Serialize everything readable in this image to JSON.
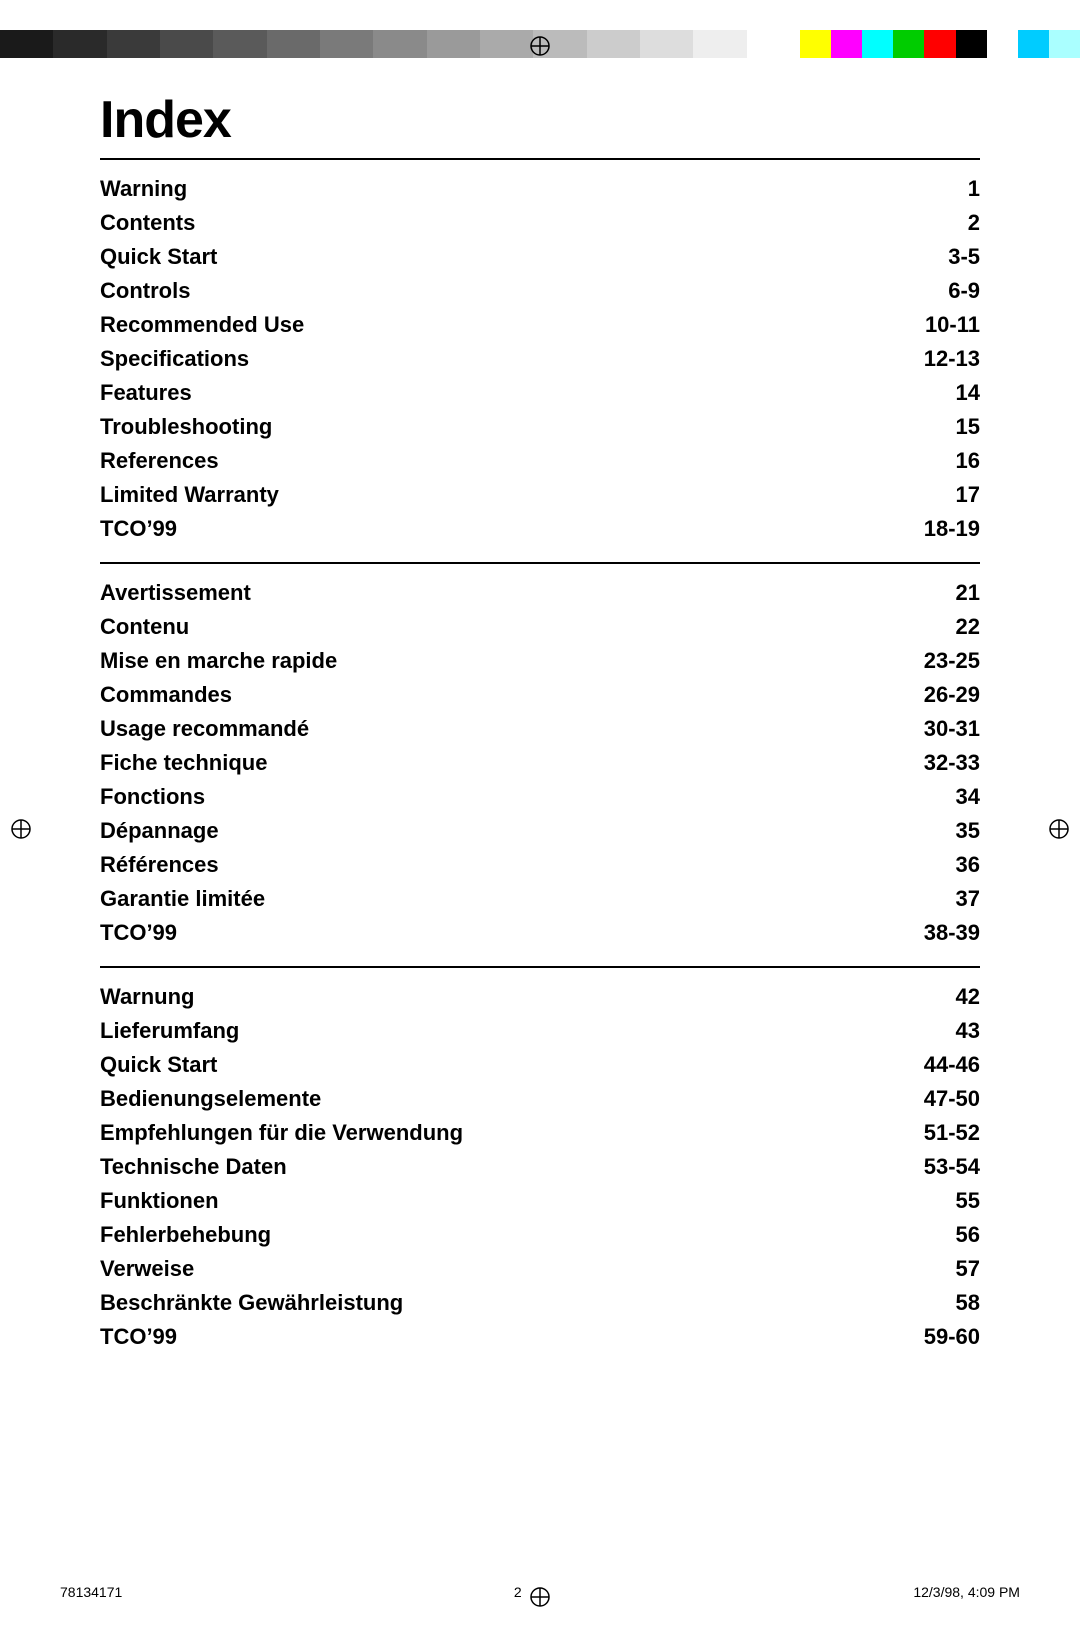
{
  "colorBar": {
    "swatches": [
      "#1a1a1a",
      "#333333",
      "#4d4d4d",
      "#666666",
      "#808080",
      "#999999",
      "#b3b3b3",
      "#cccccc",
      "#e6e6e6",
      "#ffffff",
      "#ffff00",
      "#ff00ff",
      "#00ffff",
      "#00cc00",
      "#ff0000",
      "#000000",
      "#ffffff",
      "#00ccff",
      "#ffffff"
    ]
  },
  "pageTitle": "Index",
  "sections": [
    {
      "id": "english",
      "items": [
        {
          "label": "Warning",
          "page": "1"
        },
        {
          "label": "Contents",
          "page": "2"
        },
        {
          "label": "Quick Start",
          "page": "3-5"
        },
        {
          "label": "Controls",
          "page": "6-9"
        },
        {
          "label": "Recommended Use",
          "page": "10-11"
        },
        {
          "label": "Specifications",
          "page": "12-13"
        },
        {
          "label": "Features",
          "page": "14"
        },
        {
          "label": "Troubleshooting",
          "page": "15"
        },
        {
          "label": "References",
          "page": "16"
        },
        {
          "label": "Limited Warranty",
          "page": "17"
        },
        {
          "label": "TCO’99",
          "page": "18-19"
        }
      ]
    },
    {
      "id": "french",
      "items": [
        {
          "label": "Avertissement",
          "page": "21"
        },
        {
          "label": "Contenu",
          "page": "22"
        },
        {
          "label": "Mise en marche rapide",
          "page": "23-25"
        },
        {
          "label": "Commandes",
          "page": "26-29"
        },
        {
          "label": "Usage recommandé",
          "page": "30-31"
        },
        {
          "label": "Fiche technique",
          "page": "32-33"
        },
        {
          "label": "Fonctions",
          "page": "34"
        },
        {
          "label": "Dépannage",
          "page": "35"
        },
        {
          "label": "Références",
          "page": "36"
        },
        {
          "label": "Garantie limitée",
          "page": "37"
        },
        {
          "label": "TCO’99",
          "page": "38-39"
        }
      ]
    },
    {
      "id": "german",
      "items": [
        {
          "label": "Warnung",
          "page": "42"
        },
        {
          "label": "Lieferumfang",
          "page": "43"
        },
        {
          "label": "Quick Start",
          "page": "44-46"
        },
        {
          "label": "Bedienungselemente",
          "page": "47-50"
        },
        {
          "label": "Empfehlungen für die Verwendung",
          "page": "51-52"
        },
        {
          "label": "Technische Daten",
          "page": "53-54"
        },
        {
          "label": "Funktionen",
          "page": "55"
        },
        {
          "label": "Fehlerbehebung",
          "page": "56"
        },
        {
          "label": "Verweise",
          "page": "57"
        },
        {
          "label": "Beschränkte Gewährleistung",
          "page": "58"
        },
        {
          "label": "TCO’99",
          "page": "59-60"
        }
      ]
    }
  ],
  "footer": {
    "left": "78134171",
    "center": "2",
    "right": "12/3/98, 4:09 PM"
  }
}
